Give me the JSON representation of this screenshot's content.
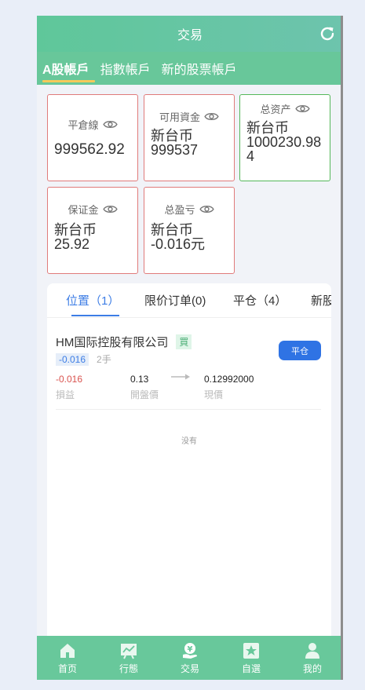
{
  "header": {
    "title": "交易"
  },
  "account_tabs": [
    "A股帳戶",
    "指數帳戶",
    "新的股票帳戶"
  ],
  "cards": [
    {
      "label": "平倉線",
      "value": "999562.92"
    },
    {
      "label": "可用資金",
      "value": "新台币\n999537"
    },
    {
      "label": "总资产",
      "value": "新台币\n1000230.984"
    },
    {
      "label": "保证金",
      "value": "新台币\n25.92"
    },
    {
      "label": "总盈亏",
      "value": "新台币\n-0.016元"
    }
  ],
  "position_tabs": [
    "位置（1）",
    "限价订单(0)",
    "平仓（4）",
    "新股"
  ],
  "position": {
    "name": "HM国际控股有限公司",
    "side": "買",
    "change": "-0.016",
    "lots": "2手",
    "close_label": "平仓",
    "pnl_value": "-0.016",
    "pnl_label": "損益",
    "open_value": "0.13",
    "open_label": "開盤價",
    "current_value": "0.12992000",
    "current_label": "現價"
  },
  "empty_text": "没有",
  "bottom_nav": [
    "首页",
    "行態",
    "交易",
    "自選",
    "我的"
  ],
  "colors": {
    "header": "#68c79a",
    "accent": "#2f73e4",
    "negative": "#d9534f",
    "tab_indicator": "#f5c95a"
  }
}
